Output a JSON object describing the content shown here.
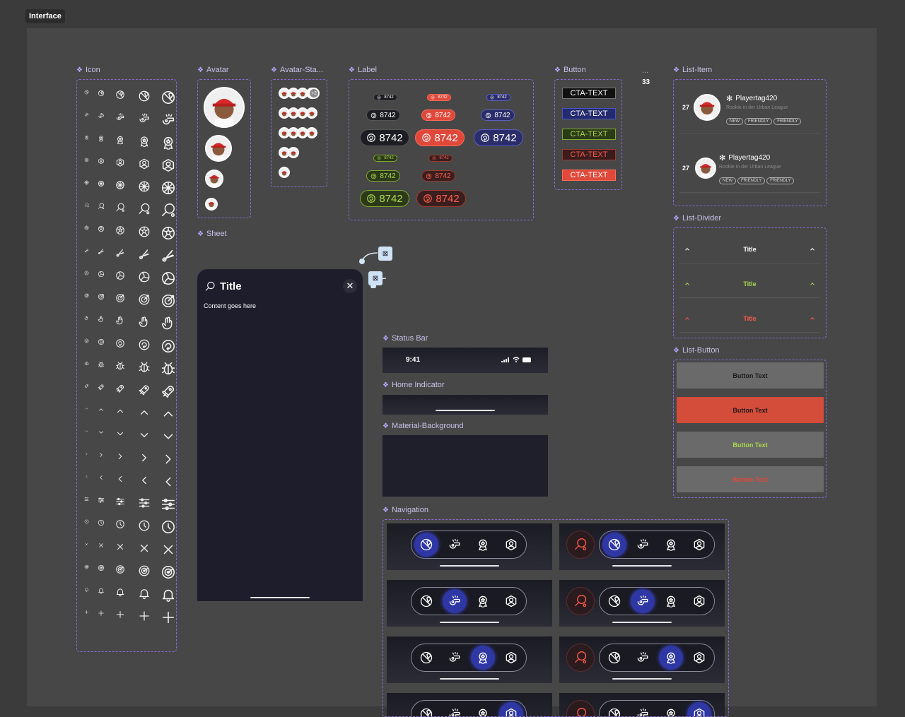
{
  "frame": {
    "title": "Interface"
  },
  "sections": {
    "icon": "Icon",
    "avatar": "Avatar",
    "avatar_stack": "Avatar-Sta...",
    "label": "Label",
    "button": "Button",
    "ellipsis": "...",
    "ellipsis_count": "33",
    "list_item": "List-Item",
    "sheet": "Sheet",
    "status_bar": "Status Bar",
    "home_indicator": "Home Indicator",
    "material_background": "Material-Background",
    "list_divider": "List-Divider",
    "list_button": "List-Button",
    "navigation": "Navigation"
  },
  "icon_rows": [
    "pin-ball",
    "whistle",
    "medal",
    "user",
    "soccer",
    "pingpong",
    "soccer-ball",
    "shuttlecock",
    "volleyball",
    "target",
    "hand-wave",
    "rotate",
    "bug",
    "rocket",
    "chevron-up",
    "chevron-down",
    "chevron-right",
    "chevron-left",
    "sliders",
    "clock",
    "close",
    "radar",
    "bell",
    "plus"
  ],
  "avatar_stack": {
    "overflow": "+2"
  },
  "labels": {
    "value": "8742"
  },
  "buttons": {
    "cta_text": "CTA-TEXT"
  },
  "colors": {
    "accent_blue": "#2e37a4",
    "accent_red": "#e0483a",
    "accent_green": "#a9d94c",
    "border_purple": "#8a6bd6"
  },
  "list_items": [
    {
      "rank": "27",
      "name": "Playertag420",
      "subtitle": "Rookie in der Urban League",
      "tags": [
        "NEW",
        "FRIENDLY",
        "FRIENDLY"
      ]
    },
    {
      "rank": "27",
      "name": "Playertag420",
      "subtitle": "Rookie in der Urban League",
      "tags": [
        "NEW",
        "FRIENDLY",
        "FRIENDLY"
      ]
    }
  ],
  "list_dividers": [
    {
      "title": "Title",
      "color": "#ffffff"
    },
    {
      "title": "Title",
      "color": "#a9d94c"
    },
    {
      "title": "Title",
      "color": "#ff5a48"
    }
  ],
  "list_buttons": [
    {
      "text": "Button Text",
      "bg": "#6a6a6a",
      "fg": "#1a1a1a"
    },
    {
      "text": "Button Text",
      "bg": "#d44c3a",
      "fg": "#1a1a1a"
    },
    {
      "text": "Button Text",
      "bg": "#6a6a6a",
      "fg": "#a9d94c"
    },
    {
      "text": "Button Text",
      "bg": "#6a6a6a",
      "fg": "#e0483a"
    }
  ],
  "sheet": {
    "title": "Title",
    "content": "Content goes here"
  },
  "status_bar": {
    "time": "9:41"
  }
}
